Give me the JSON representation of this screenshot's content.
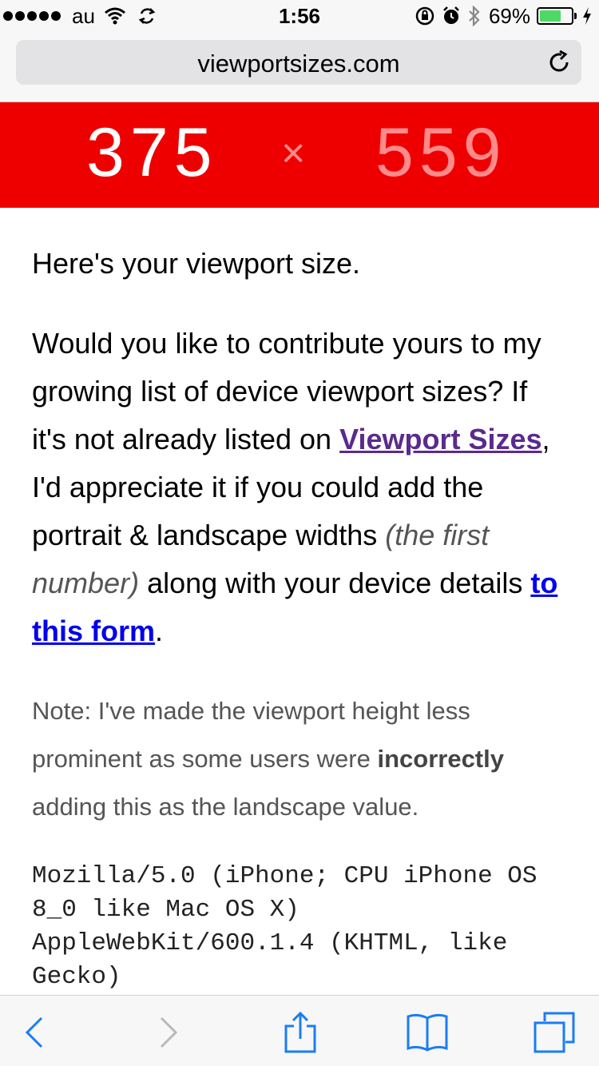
{
  "status_bar": {
    "carrier": "au",
    "time": "1:56",
    "battery_percent": "69%",
    "battery_level": 0.69,
    "icons": [
      "signal-dots",
      "wifi-icon",
      "sync-icon",
      "rotation-lock-icon",
      "alarm-icon",
      "bluetooth-icon",
      "battery-icon",
      "charging-bolt-icon"
    ]
  },
  "browser": {
    "url": "viewportsizes.com"
  },
  "banner": {
    "width": "375",
    "separator": "×",
    "height": "559"
  },
  "content": {
    "intro": "Here's your viewport size.",
    "p1_a": "Would you like to contribute yours to my growing list of device viewport sizes? If it's not already listed on ",
    "p1_link1": "Viewport Sizes",
    "p1_b": ", I'd appreciate it if you could add the portrait & landscape widths ",
    "p1_em": "(the first number)",
    "p1_c": " along with your device details ",
    "p1_link2": "to this form",
    "p1_d": ".",
    "note_a": "Note: I've made the viewport height less prominent as some users were ",
    "note_bold": "incorrectly",
    "note_b": " adding this as the landscape value.",
    "user_agent": "Mozilla/5.0 (iPhone; CPU iPhone OS 8_0 like Mac OS X) AppleWebKit/600.1.4 (KHTML, like Gecko)"
  },
  "colors": {
    "banner_bg": "#ee0000",
    "visited_link": "#5a2a8c",
    "link": "#0000ee",
    "toolbar_icon": "#1a7cf5"
  }
}
